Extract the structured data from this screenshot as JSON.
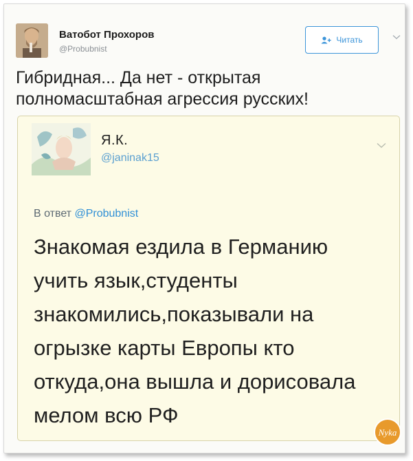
{
  "tweet": {
    "author_name": "Ватобот Прохоров",
    "author_handle": "@Probubnist",
    "follow_label": "Читать",
    "text_line1": "Гибридная... Да нет - открытая",
    "text_line2": "полномасштабная агрессия русских!"
  },
  "quoted_tweet": {
    "author_name": "Я.К.",
    "author_handle": "@janinak15",
    "reply_prefix": "В ответ",
    "reply_handle": "@Probubnist",
    "lines": [
      "Знакомая ездила в Германию",
      "учить язык,студенты",
      "знакомились,показывали на",
      "огрызке карты Европы кто",
      "откуда,она вышла и дорисовала",
      "мелом всю РФ"
    ]
  },
  "watermark": {
    "text": "Nyka"
  },
  "colors": {
    "accent": "#3b94d9",
    "link": "#2f8fd6",
    "quote_background": "#fdfbe6",
    "watermark": "#e89a2c"
  },
  "icons": {
    "follow": "person-add-icon",
    "menu": "chevron-down-icon"
  }
}
